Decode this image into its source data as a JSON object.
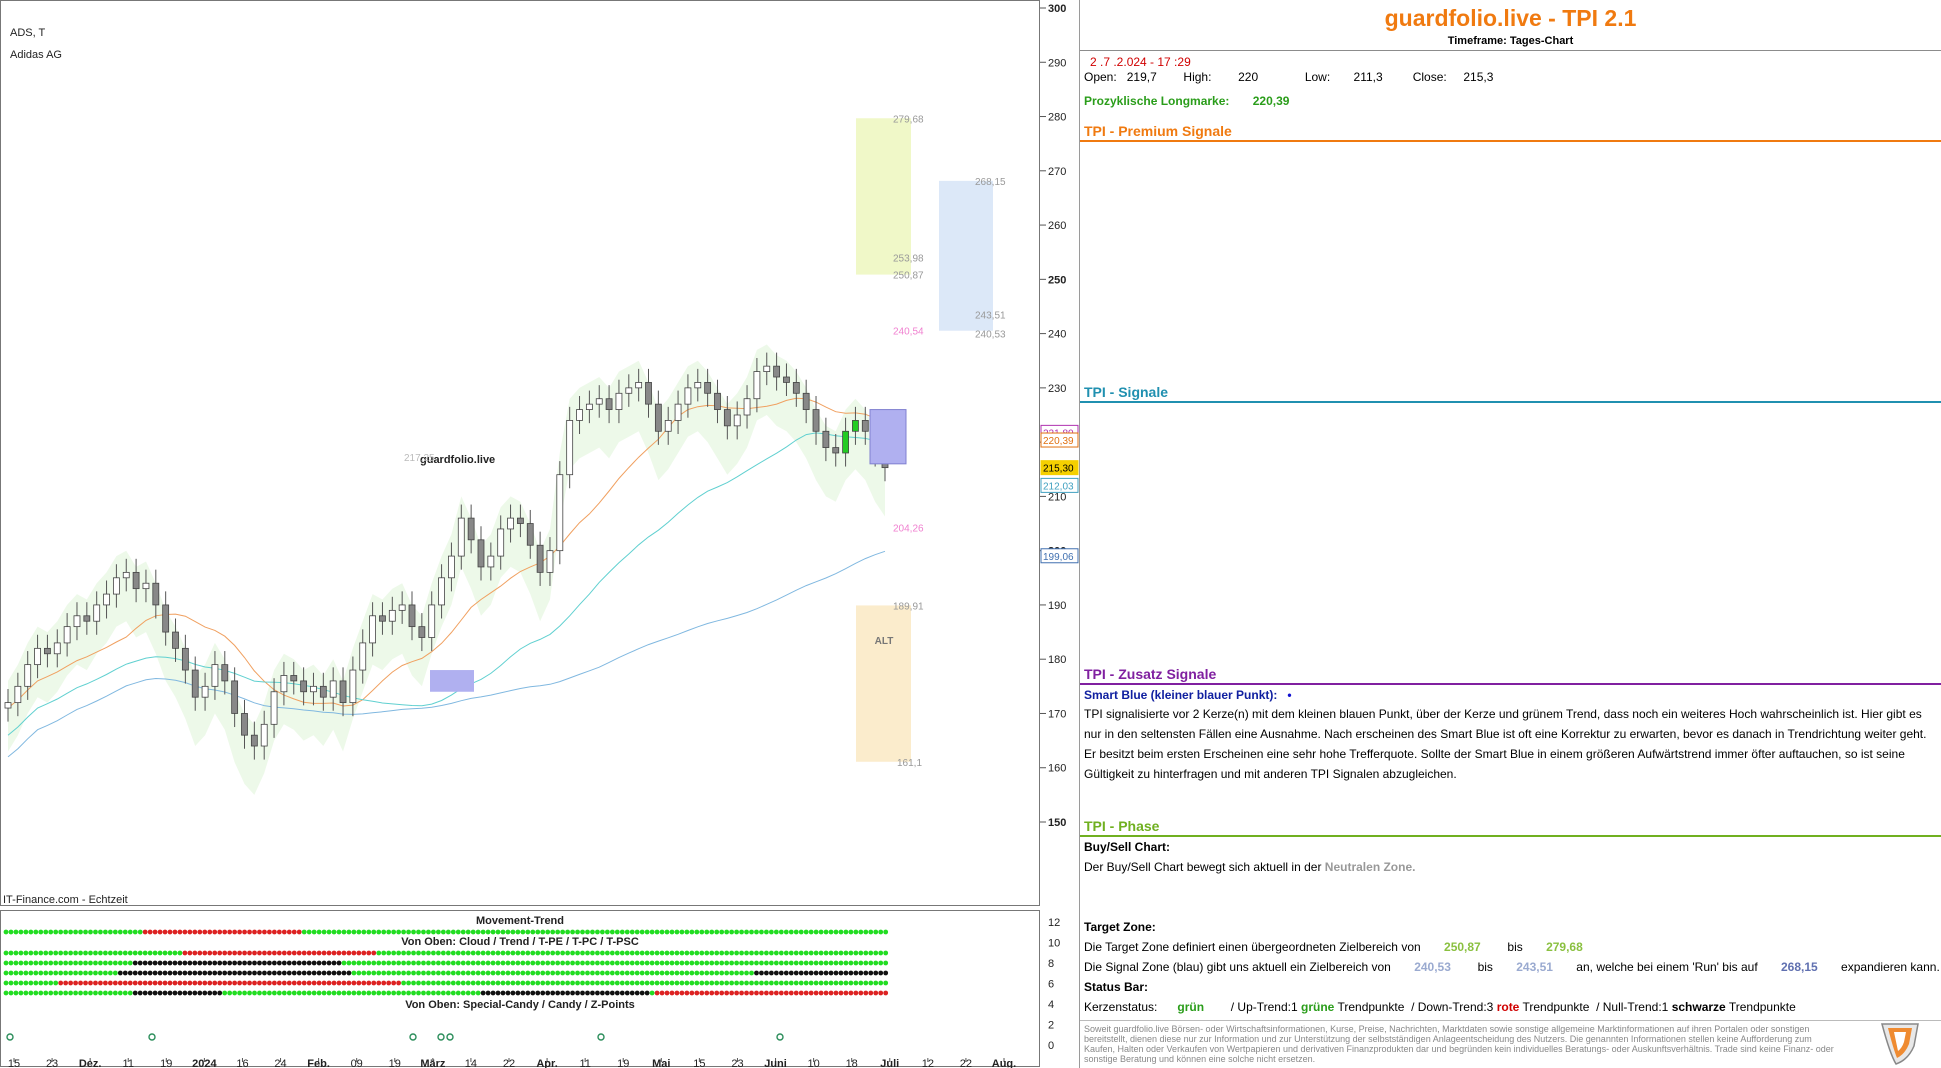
{
  "header": {
    "symbol": "ADS, T",
    "name": "Adidas AG",
    "watermark": "guardfolio.live",
    "source": "IT-Finance.com - Echtzeit"
  },
  "chart_data": {
    "type": "candlestick",
    "ylim": [
      140,
      300
    ],
    "y_ticks": [
      150,
      160,
      170,
      180,
      190,
      200,
      210,
      220,
      230,
      240,
      250,
      260,
      270,
      280,
      290,
      300
    ],
    "x_labels": [
      "15",
      "23",
      "Dez.",
      "11",
      "19",
      "2024",
      "16",
      "24",
      "Feb.",
      "09",
      "19",
      "März",
      "14",
      "22",
      "Apr.",
      "11",
      "19",
      "Mai",
      "15",
      "23",
      "Juni",
      "10",
      "18",
      "Juli",
      "12",
      "22",
      "Aug."
    ],
    "closes": [
      172,
      175,
      179,
      182,
      181,
      183,
      186,
      188,
      187,
      190,
      192,
      195,
      196,
      193,
      194,
      190,
      185,
      182,
      178,
      173,
      175,
      179,
      176,
      170,
      166,
      164,
      168,
      174,
      177,
      176,
      174,
      175,
      173,
      176,
      172,
      178,
      183,
      188,
      187,
      189,
      190,
      186,
      184,
      190,
      195,
      199,
      206,
      202,
      197,
      199,
      204,
      206,
      205,
      201,
      196,
      200,
      214,
      224,
      226,
      227,
      228,
      226,
      229,
      230,
      231,
      227,
      222,
      224,
      227,
      230,
      231,
      229,
      226,
      223,
      225,
      228,
      233,
      234,
      232,
      231,
      229,
      226,
      222,
      219,
      218,
      222,
      224,
      222,
      218,
      215.3
    ],
    "zones": {
      "target": [
        250.87,
        279.68
      ],
      "signal": [
        240.53,
        243.51,
        268.15
      ],
      "target_labels": [
        "279,68",
        "253,98",
        "250,87"
      ],
      "signal_labels": [
        "268,15",
        "243,51",
        "240,53"
      ],
      "alt_zone": [
        161.1,
        189.91
      ],
      "alt_labels": [
        "189,91",
        "161,1"
      ],
      "alt_text": "ALT",
      "pink_labels": [
        "240,54",
        "204,26"
      ],
      "grey_label": "217,25"
    },
    "price_tags": [
      {
        "value": 221.8,
        "label": "221,80",
        "color": "#b030b0"
      },
      {
        "value": 220.39,
        "label": "220,39",
        "color": "#e07010"
      },
      {
        "value": 215.3,
        "label": "215,30",
        "color": "#f5d000"
      },
      {
        "value": 212.03,
        "label": "212,03",
        "color": "#40a0c0"
      },
      {
        "value": 199.06,
        "label": "199,06",
        "color": "#4070b0"
      }
    ],
    "indicator_titles": [
      "Movement-Trend",
      "Von Oben: Cloud / Trend / T-PE / T-PC / T-PSC",
      "Von Oben: Special-Candy / Candy / Z-Points"
    ],
    "indicator_ticks": [
      12,
      10,
      8,
      6,
      4,
      2,
      0
    ]
  },
  "panel": {
    "title": "guardfolio.live - TPI 2.1",
    "subtitle": "Timeframe: Tages-Chart",
    "datetime": "2 .7 .2.024  - 17 :29",
    "open_label": "Open:",
    "open": "219,7",
    "high_label": "High:",
    "high": "220",
    "low_label": "Low:",
    "low": "211,3",
    "close_label": "Close:",
    "close": "215,3",
    "longmarke_label": "Prozyklische Longmarke:",
    "longmarke": "220,39",
    "premium_title": "TPI - Premium Signale",
    "signale_title": "TPI - Signale",
    "zusatz_title": "TPI - Zusatz Signale",
    "smart_blue_label": "Smart Blue (kleiner blauer Punkt):",
    "smart_blue_dot": "•",
    "smart_blue_text": "TPI signalisierte vor 2  Kerze(n) mit dem kleinen blauen Punkt, über der Kerze und grünem Trend, dass noch ein weiteres Hoch wahrscheinlich ist. Hier gibt es nur in den seltensten Fällen eine Ausnahme. Nach erscheinen des Smart Blue ist oft eine Korrektur zu erwarten, bevor es danach in Trendrichtung weiter geht. Er besitzt beim ersten Erscheinen eine sehr hohe Trefferquote. Sollte der Smart Blue in einem größeren Aufwärtstrend immer öfter auftauchen, so ist seine Gültigkeit zu hinterfragen und mit anderen TPI Signalen abzugleichen.",
    "phase_title": "TPI - Phase",
    "buysell_label": "Buy/Sell Chart:",
    "buysell_text": "Der Buy/Sell Chart bewegt sich aktuell in der",
    "buysell_zone": "Neutralen Zone.",
    "target_label": "Target Zone:",
    "target_text": "Die Target Zone definiert einen übergeordneten Zielbereich von",
    "target_from": "250,87",
    "bis": "bis",
    "target_to": "279,68",
    "signal_text": "Die Signal Zone (blau) gibt uns aktuell ein Zielbereich von",
    "signal_from": "240,53",
    "signal_to": "243,51",
    "signal_text2": "an, welche bei einem 'Run' bis auf",
    "signal_run": "268,15",
    "signal_text3": "expandieren kann.",
    "status_label": "Status Bar:",
    "kerzen_label": "Kerzenstatus:",
    "kerzen_value": "grün",
    "up_text": "/ Up-Trend:1",
    "up_color": "grüne",
    "tp1": "Trendpunkte",
    "down_text": "/ Down-Trend:3",
    "down_color": "rote",
    "tp2": "Trendpunkte",
    "null_text": "/ Null-Trend:1",
    "null_color": "schwarze",
    "tp3": "Trendpunkte",
    "disclaimer": "Soweit guardfolio.live Börsen- oder Wirtschaftsinformationen, Kurse, Preise, Nachrichten, Marktdaten sowie sonstige allgemeine Marktinformationen auf ihren Portalen oder sonstigen bereitstellt, dienen diese nur zur Information und zur Unterstützung der selbstständigen Anlageentscheidung des Nutzers. Die genannten Informationen stellen keine Aufforderung zum Kaufen, Halten oder Verkaufen von Wertpapieren und derivativen Finanzprodukten dar und begründen kein individuelles Beratungs- oder Auskunftsverhältnis. Trade sind keine Finanz- oder sonstige Beratung und können eine solche nicht ersetzen."
  },
  "colors": {
    "title": "#f07a10",
    "premium": "#f07a10",
    "signale": "#2090b0",
    "zusatz": "#8020a0",
    "phase": "#70b020",
    "green": "#2a9d1a",
    "red": "#d00000"
  }
}
